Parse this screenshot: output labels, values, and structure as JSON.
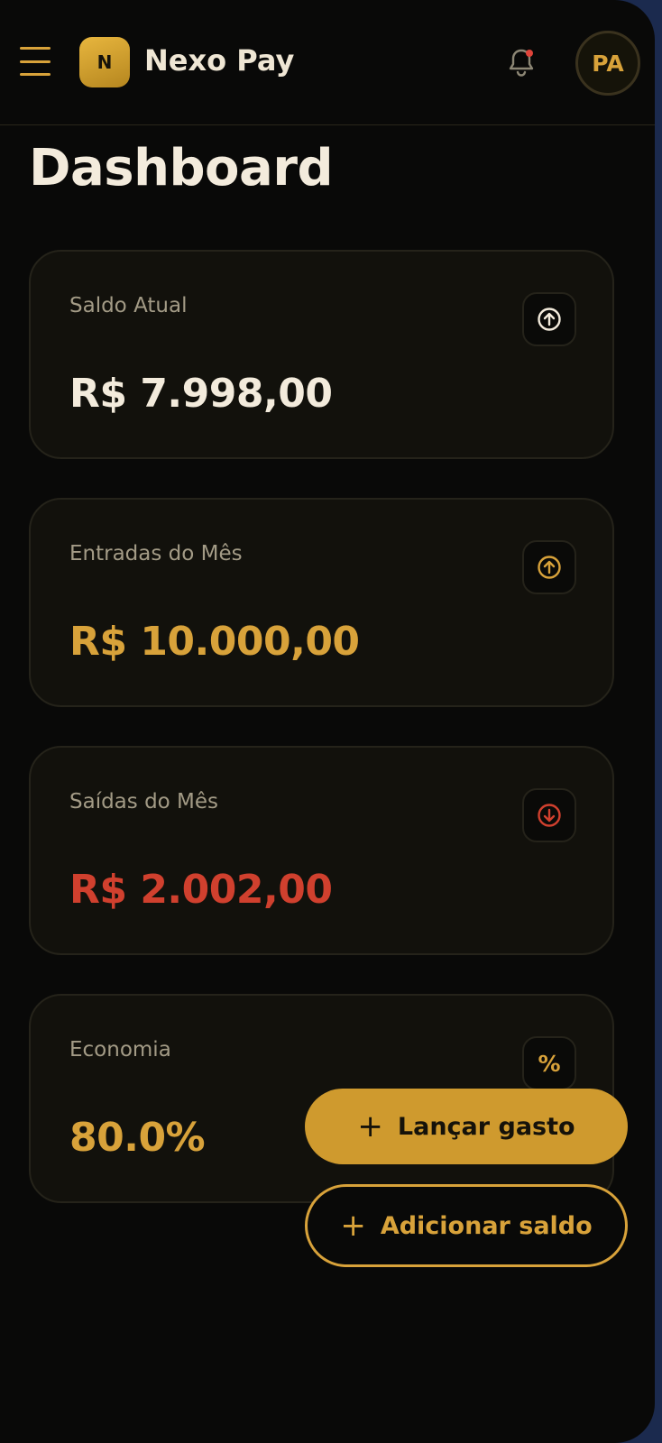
{
  "header": {
    "logo_letter": "N",
    "brand": "Nexo Pay",
    "avatar_initials": "PA"
  },
  "page": {
    "title": "Dashboard"
  },
  "cards": [
    {
      "label": "Saldo Atual",
      "value": "R$ 7.998,00",
      "icon": "arrow-up-circle-icon",
      "value_color": "#f3ebdc"
    },
    {
      "label": "Entradas do Mês",
      "value": "R$ 10.000,00",
      "icon": "arrow-up-circle-icon",
      "value_color": "#d8a23a"
    },
    {
      "label": "Saídas do Mês",
      "value": "R$ 2.002,00",
      "icon": "arrow-down-circle-icon",
      "value_color": "#d0402e"
    },
    {
      "label": "Economia",
      "value": "80.0%",
      "icon": "percent-icon",
      "icon_text": "%",
      "value_color": "#d8a23a"
    }
  ],
  "actions": {
    "primary_label": "Lançar gasto",
    "secondary_label": "Adicionar saldo",
    "plus": "+"
  },
  "colors": {
    "accent": "#d8a23a",
    "negative": "#d0402e",
    "background": "#090908"
  }
}
